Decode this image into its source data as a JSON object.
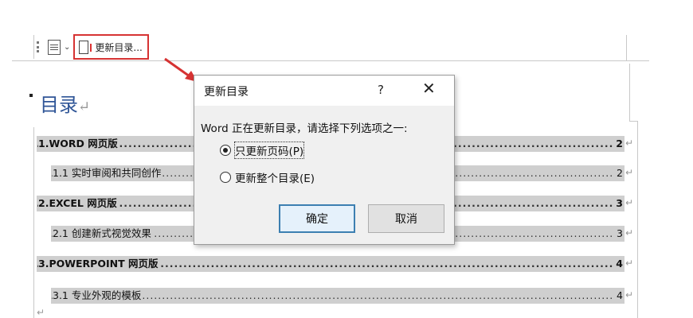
{
  "toolbar": {
    "update_label": "更新目录..."
  },
  "document": {
    "title": "目录",
    "paragraph_mark": "↵",
    "entries": [
      {
        "text": "1.WORD  网页版",
        "page": "2"
      },
      {
        "text": "1.1 实时审阅和共同创作",
        "page": "2"
      },
      {
        "text": "2.EXCEL  网页版",
        "page": "3"
      },
      {
        "text": "2.1 创建新式视觉效果",
        "page": "3"
      },
      {
        "text": "3.POWERPOINT  网页版",
        "page": "4"
      },
      {
        "text": "3.1 专业外观的模板",
        "page": "4"
      }
    ]
  },
  "dialog": {
    "title": "更新目录",
    "help": "?",
    "close": "✕",
    "message": "Word 正在更新目录，请选择下列选项之一:",
    "option_pages_only": "只更新页码(P)",
    "option_entire": "更新整个目录(E)",
    "ok_label": "确定",
    "cancel_label": "取消"
  },
  "colors": {
    "title": "#2f5597",
    "highlight": "#d63333",
    "field_shading": "#cfcfcf"
  }
}
